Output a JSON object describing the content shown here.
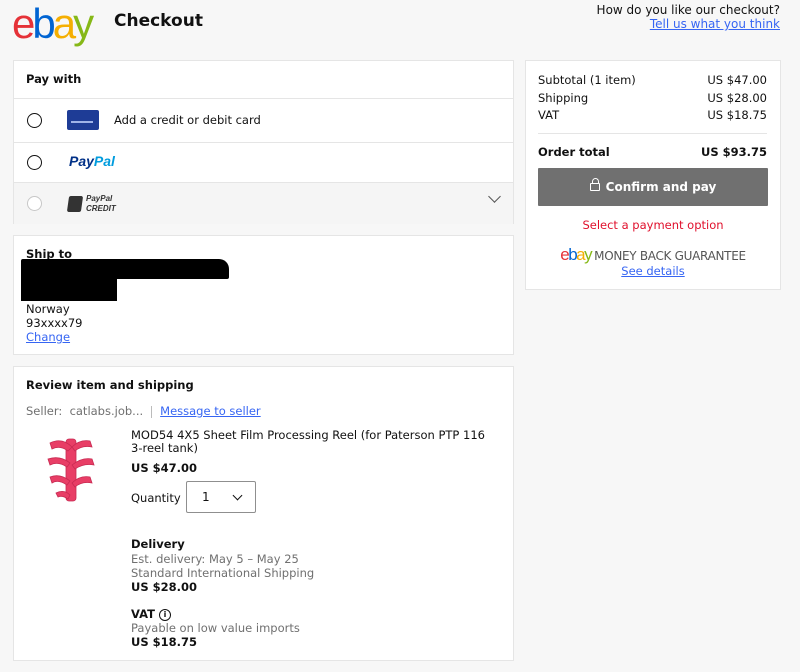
{
  "header": {
    "logo": {
      "e": "e",
      "b": "b",
      "a": "a",
      "y": "y"
    },
    "title": "Checkout",
    "feedback_question": "How do you like our checkout?",
    "feedback_link": "Tell us what you think"
  },
  "pay_with": {
    "title": "Pay with",
    "options": [
      {
        "label": "Add a credit or debit card",
        "icon": "credit-card-icon",
        "selected": false,
        "disabled": false
      },
      {
        "label": "PayPal",
        "icon": "paypal-logo",
        "selected": false,
        "disabled": false
      },
      {
        "label_line1": "PayPal",
        "label_line2": "CREDIT",
        "icon": "paypal-credit-logo",
        "selected": false,
        "disabled": true
      }
    ]
  },
  "ship_to": {
    "title": "Ship to",
    "country": "Norway",
    "phone": "93xxxx79",
    "change_link": "Change"
  },
  "review": {
    "title": "Review item and shipping",
    "seller_label": "Seller:",
    "seller_name": "catlabs.job...",
    "message_link": "Message to seller",
    "item": {
      "title": "MOD54 4X5 Sheet Film Processing Reel (for Paterson PTP 116 3-reel tank)",
      "price": "US $47.00",
      "quantity_label": "Quantity",
      "quantity": "1"
    },
    "delivery": {
      "title": "Delivery",
      "est": "Est. delivery: May 5 – May 25",
      "method": "Standard International Shipping",
      "price": "US $28.00"
    },
    "vat": {
      "title": "VAT",
      "note": "Payable on low value imports",
      "price": "US $18.75"
    }
  },
  "summary": {
    "subtotal_label": "Subtotal (1 item)",
    "subtotal": "US $47.00",
    "shipping_label": "Shipping",
    "shipping": "US $28.00",
    "vat_label": "VAT",
    "vat": "US $18.75",
    "total_label": "Order total",
    "total": "US $93.75",
    "confirm_button": "Confirm and pay",
    "select_message": "Select a payment option",
    "guarantee": "MONEY BACK GUARANTEE",
    "see_details": "See details"
  },
  "colors": {
    "link": "#3665f3",
    "error": "#e0102c",
    "button_disabled": "#707070"
  }
}
